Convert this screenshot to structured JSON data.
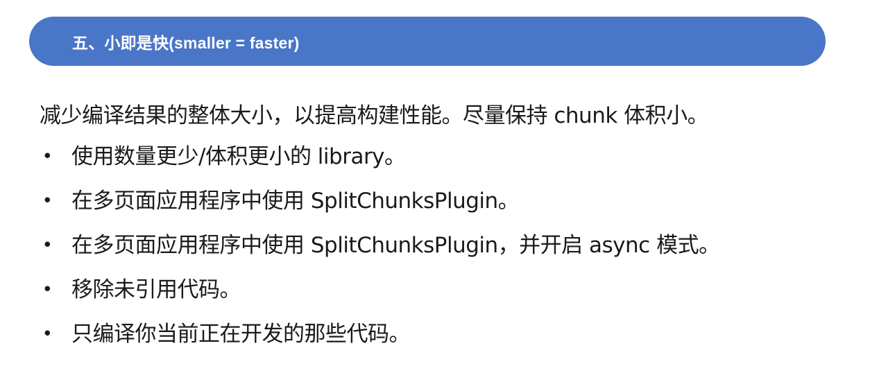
{
  "banner": {
    "title": "五、小即是快(smaller = faster)"
  },
  "intro": "减少编译结果的整体大小，以提高构建性能。尽量保持 chunk 体积小。",
  "bullet_glyph": "•",
  "bullets": [
    "使用数量更少/体积更小的 library。",
    "在多页面应用程序中使用 SplitChunksPlugin。",
    "在多页面应用程序中使用 SplitChunksPlugin，并开启 async 模式。",
    "移除未引用代码。",
    "只编译你当前正在开发的那些代码。"
  ],
  "colors": {
    "banner_background": "#4a76c7",
    "banner_text": "#ffffff",
    "body_text": "#1a1a1a"
  }
}
